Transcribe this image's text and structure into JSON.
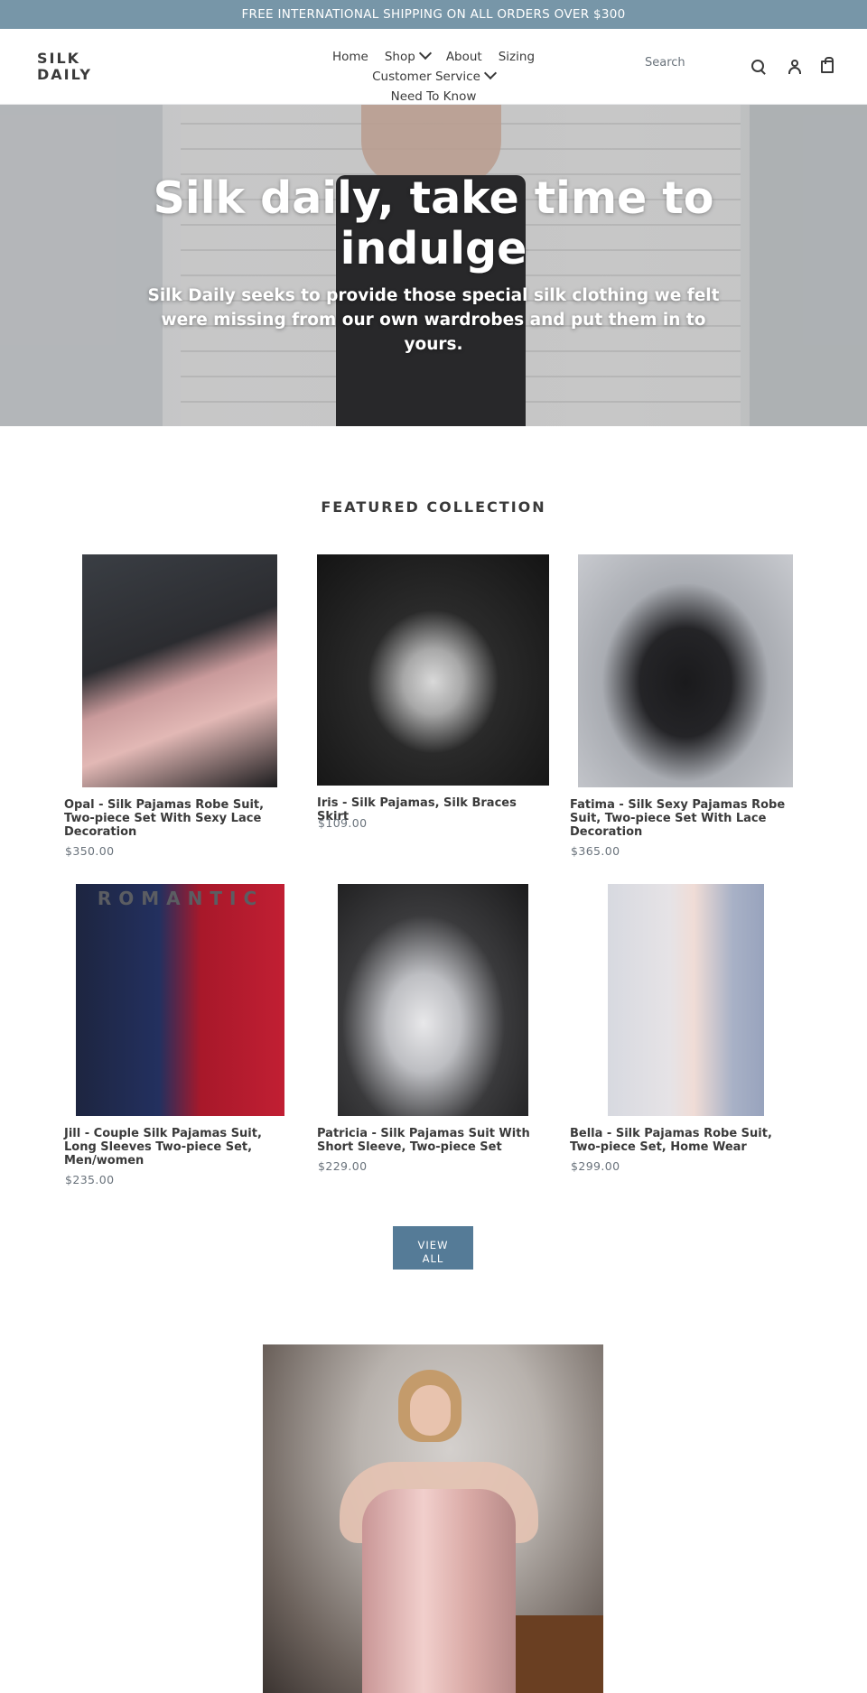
{
  "announcement": "FREE INTERNATIONAL SHIPPING ON ALL ORDERS OVER $300",
  "header": {
    "logo_line1": "SILK",
    "logo_line2": "DAILY",
    "nav": {
      "home": "Home",
      "shop": "Shop",
      "about": "About",
      "sizing": "Sizing",
      "customer_service": "Customer Service",
      "need_to_know": "Need To Know"
    },
    "search_placeholder": "Search",
    "icons": [
      "search-icon",
      "account-icon",
      "cart-icon",
      "chevron-down-icon"
    ]
  },
  "hero": {
    "title": "Silk daily, take time to indulge",
    "subtitle": "Silk Daily seeks to provide those special silk clothing we felt were missing from our own wardrobes and put them in to yours."
  },
  "featured": {
    "title": "FEATURED COLLECTION",
    "products": [
      {
        "title": "Opal - Silk Pajamas Robe Suit, Two-piece Set With Sexy Lace Decoration",
        "price": "$350.00"
      },
      {
        "title": "Iris - Silk Pajamas, Silk Braces Skirt",
        "price": "$109.00"
      },
      {
        "title": "Fatima - Silk Sexy Pajamas Robe Suit, Two-piece Set With Lace Decoration",
        "price": "$365.00"
      },
      {
        "title": "Jill - Couple Silk Pajamas Suit, Long Sleeves Two-piece Set, Men/women",
        "price": "$235.00"
      },
      {
        "title": "Patricia - Silk Pajamas Suit With Short Sleeve, Two-piece Set",
        "price": "$229.00"
      },
      {
        "title": "Bella - Silk Pajamas Robe Suit, Two-piece Set, Home Wear",
        "price": "$299.00"
      }
    ],
    "view_all_line1": "VIEW",
    "view_all_line2": "ALL",
    "romantic_overlay": "ROMANTIC"
  },
  "colors": {
    "announcement_bg": "#7796a8",
    "button_bg": "#557b97",
    "text": "#3a3a3a",
    "price": "#69727b"
  }
}
